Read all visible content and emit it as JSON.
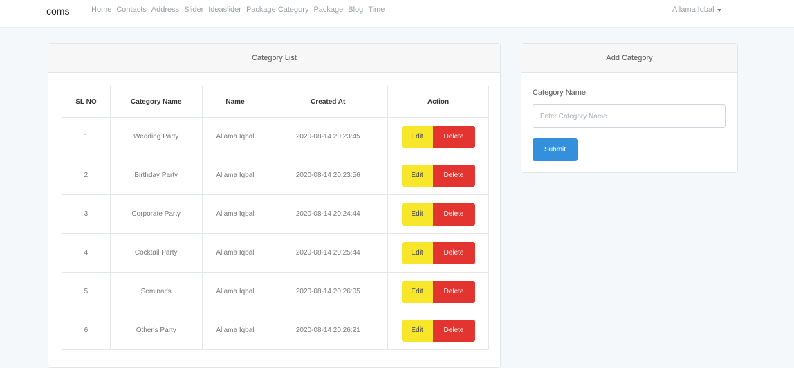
{
  "nav": {
    "brand": "coms",
    "links": [
      "Home",
      "Contacts",
      "Address",
      "Slider",
      "Ideaslider",
      "Package Category",
      "Package",
      "Blog",
      "Time"
    ],
    "user": "Allama Iqbal"
  },
  "list": {
    "title": "Category List",
    "headers": [
      "SL NO",
      "Category Name",
      "Name",
      "Created At",
      "Action"
    ],
    "edit_label": "Edit",
    "delete_label": "Delete",
    "rows": [
      {
        "sl": "1",
        "category": "Wedding Party",
        "name": "Allama Iqbal",
        "created": "2020-08-14 20:23:45"
      },
      {
        "sl": "2",
        "category": "Birthday Party",
        "name": "Allama Iqbal",
        "created": "2020-08-14 20:23:56"
      },
      {
        "sl": "3",
        "category": "Corporate Party",
        "name": "Allama Iqbal",
        "created": "2020-08-14 20:24:44"
      },
      {
        "sl": "4",
        "category": "Cocktail Party",
        "name": "Allama Iqbal",
        "created": "2020-08-14 20:25:44"
      },
      {
        "sl": "5",
        "category": "Seminar's",
        "name": "Allama Iqbal",
        "created": "2020-08-14 20:26:05"
      },
      {
        "sl": "6",
        "category": "Other's Party",
        "name": "Allama Iqbal",
        "created": "2020-08-14 20:26:21"
      }
    ]
  },
  "add": {
    "title": "Add Category",
    "field_label": "Category Name",
    "field_placeholder": "Enter Category Name",
    "field_value": "",
    "submit_label": "Submit"
  },
  "colors": {
    "edit": "#f7e62a",
    "delete": "#e3342f",
    "submit": "#3490dc"
  }
}
